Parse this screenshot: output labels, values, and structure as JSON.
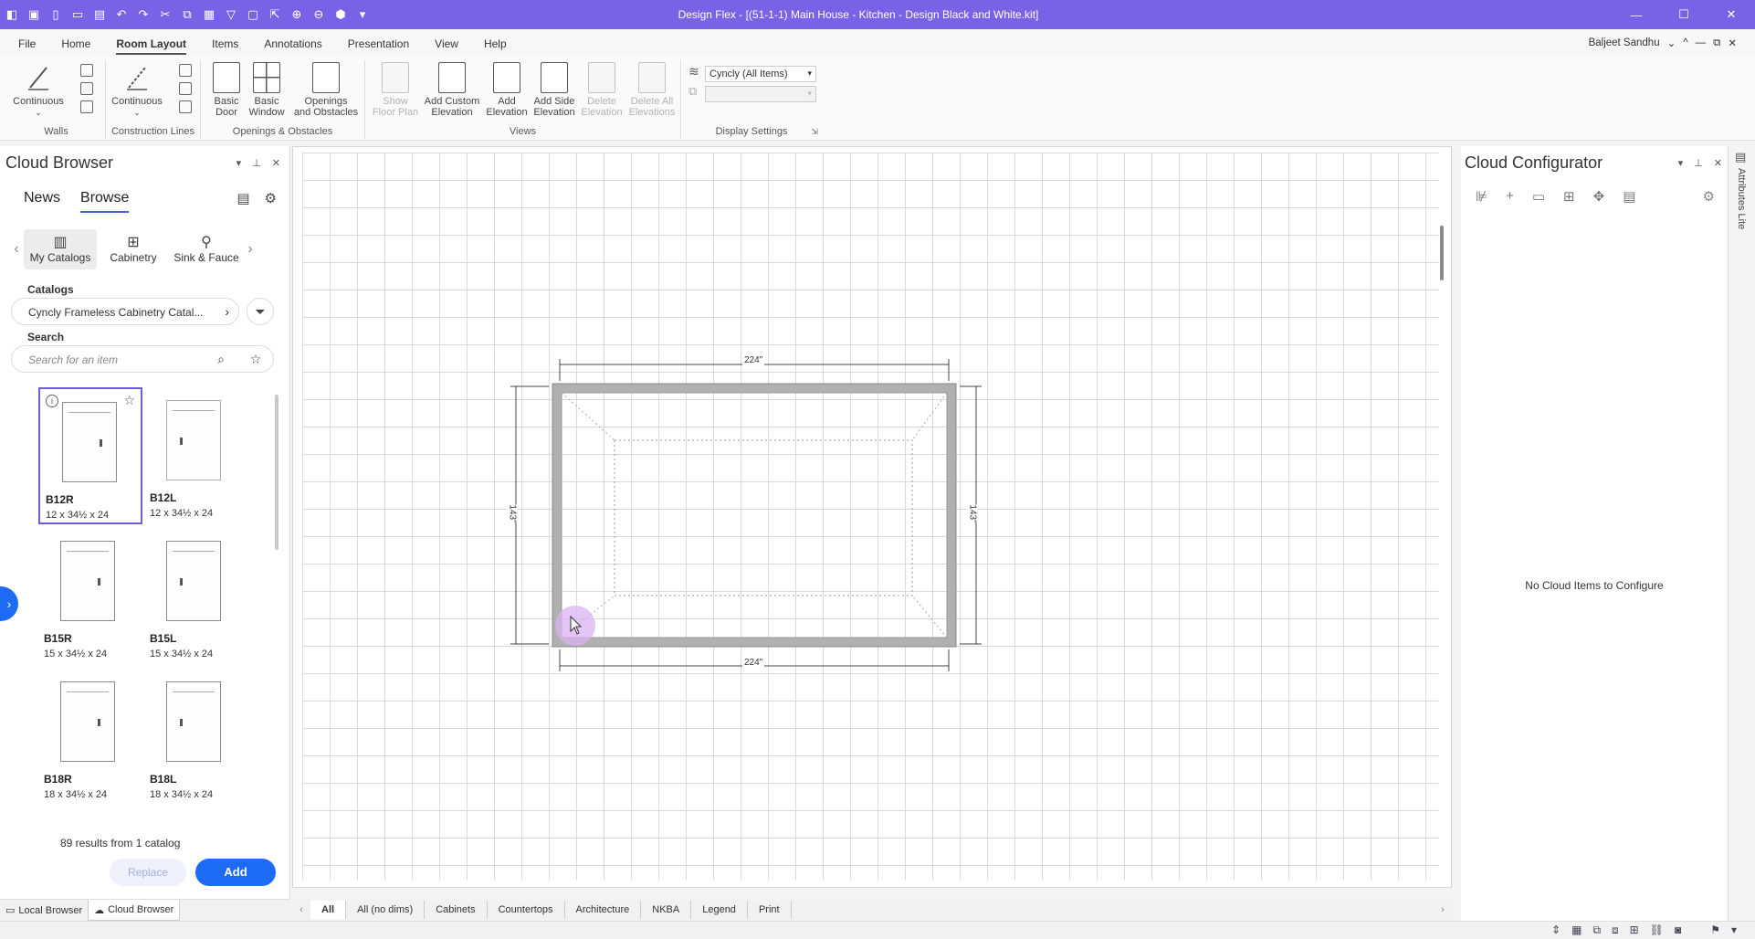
{
  "window": {
    "title": "Design Flex - [(51-1-1) Main House - Kitchen - Design Black and White.kit]",
    "controls": [
      "—",
      "☐",
      "✕"
    ]
  },
  "quick_access": [
    "logo-icon",
    "save-icon",
    "new-icon",
    "open-icon",
    "save-as-icon",
    "undo-icon",
    "redo-icon",
    "cut-icon",
    "copy-icon",
    "paste-icon",
    "format-icon",
    "panel-icon",
    "export-icon",
    "zoom-in-icon",
    "zoom-out-icon",
    "3d-icon",
    "more-icon"
  ],
  "menu": {
    "items": [
      "File",
      "Home",
      "Room Layout",
      "Items",
      "Annotations",
      "Presentation",
      "View",
      "Help"
    ],
    "active": "Room Layout",
    "user": "Baljeet Sandhu"
  },
  "ribbon": {
    "walls": {
      "label": "Walls",
      "button": "Continuous"
    },
    "construction": {
      "label": "Construction Lines",
      "button": "Continuous"
    },
    "openings": {
      "label": "Openings & Obstacles",
      "buttons": [
        {
          "l1": "Basic",
          "l2": "Door"
        },
        {
          "l1": "Basic",
          "l2": "Window"
        },
        {
          "l1": "Openings",
          "l2": "and Obstacles"
        }
      ]
    },
    "views": {
      "label": "Views",
      "buttons": [
        {
          "l1": "Show",
          "l2": "Floor Plan",
          "disabled": true
        },
        {
          "l1": "Add Custom",
          "l2": "Elevation",
          "disabled": false
        },
        {
          "l1": "Add",
          "l2": "Elevation",
          "disabled": false
        },
        {
          "l1": "Add Side",
          "l2": "Elevation",
          "disabled": false
        },
        {
          "l1": "Delete",
          "l2": "Elevation",
          "disabled": true
        },
        {
          "l1": "Delete All",
          "l2": "Elevations",
          "disabled": true
        }
      ]
    },
    "display": {
      "label": "Display Settings",
      "layer_value": "Cyncly (All Items)"
    }
  },
  "cloud_browser": {
    "title": "Cloud Browser",
    "tabs": [
      "News",
      "Browse"
    ],
    "active_tab": "Browse",
    "categories": [
      {
        "label": "My Catalogs",
        "glyph": "▥"
      },
      {
        "label": "Cabinetry",
        "glyph": "⊞"
      },
      {
        "label": "Sink & Fauce",
        "glyph": "⚲"
      }
    ],
    "catalogs_label": "Catalogs",
    "catalog_value": "Cyncly Frameless Cabinetry Catal...",
    "search_label": "Search",
    "search_placeholder": "Search for an item",
    "items": [
      {
        "name": "B12R",
        "dims": "12 x 34½ x 24",
        "selected": true
      },
      {
        "name": "B12L",
        "dims": "12 x 34½ x 24",
        "selected": false
      },
      {
        "name": "B15R",
        "dims": "15 x 34½ x 24",
        "selected": false
      },
      {
        "name": "B15L",
        "dims": "15 x 34½ x 24",
        "selected": false
      },
      {
        "name": "B18R",
        "dims": "18 x 34½ x 24",
        "selected": false
      },
      {
        "name": "B18L",
        "dims": "18 x 34½ x 24",
        "selected": false
      }
    ],
    "results": "89 results from 1 catalog",
    "replace_label": "Replace",
    "add_label": "Add",
    "bottom_tabs": [
      "Local Browser",
      "Cloud Browser"
    ]
  },
  "canvas": {
    "dim_top": "224\"",
    "dim_bottom": "224\"",
    "dim_left": "143\"",
    "dim_right": "143\"",
    "view_tabs": [
      "All",
      "All (no dims)",
      "Cabinets",
      "Countertops",
      "Architecture",
      "NKBA",
      "Legend",
      "Print"
    ],
    "active_view_tab": "All"
  },
  "cloud_configurator": {
    "title": "Cloud Configurator",
    "empty_text": "No Cloud Items to Configure",
    "side_label": "Attributes Lite"
  }
}
